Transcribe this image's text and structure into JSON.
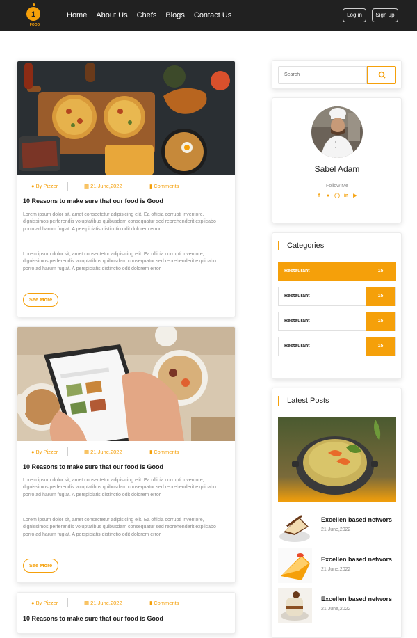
{
  "nav": {
    "links": [
      "Home",
      "About Us",
      "Chefs",
      "Blogs",
      "Contact Us"
    ],
    "login": "Log in",
    "signup": "Sign up",
    "logo_text": "FOOD"
  },
  "posts": [
    {
      "author": "By Pizzer",
      "date": "21 June,2022",
      "comments": "Comments",
      "title": "10 Reasons to make sure that our food is Good",
      "para1": "Lorem ipsum dolor sit, amet consectetur adipisicing elit. Ea officia corrupti inventore, dignissimos perferendis voluptatibus quibusdam consequatur sed reprehenderit explicabo porro ad harum fugiat. A perspiciatis distinctio odit dolorem error.",
      "para2": "Lorem ipsum dolor sit, amet consectetur adipisicing elit. Ea officia corrupti inventore, dignissimos perferendis voluptatibus quibusdam consequatur sed reprehenderit explicabo porro ad harum fugiat. A perspiciatis distinctio odit dolorem error.",
      "button": "See More",
      "image": "pizza-table"
    },
    {
      "author": "By Pizzer",
      "date": "21 June,2022",
      "comments": "Comments",
      "title": "10 Reasons to make sure that our food is Good",
      "para1": "Lorem ipsum dolor sit, amet consectetur adipisicing elit. Ea officia corrupti inventore, dignissimos perferendis voluptatibus quibusdam consequatur sed reprehenderit explicabo porro ad harum fugiat. A perspiciatis distinctio odit dolorem error.",
      "para2": "Lorem ipsum dolor sit, amet consectetur adipisicing elit. Ea officia corrupti inventore, dignissimos perferendis voluptatibus quibusdam consequatur sed reprehenderit explicabo porro ad harum fugiat. A perspiciatis distinctio odit dolorem error.",
      "button": "See More",
      "image": "tablet-breakfast"
    },
    {
      "author": "By Pizzer",
      "date": "21 June,2022",
      "comments": "Comments",
      "title": "10 Reasons to make sure that our food is Good"
    }
  ],
  "sidebar": {
    "search_placeholder": "Search",
    "profile": {
      "name": "Sabel Adam",
      "follow": "Follow Me",
      "socials": [
        "facebook-icon",
        "twitter-icon",
        "instagram-icon",
        "linkedin-icon",
        "youtube-icon"
      ]
    },
    "categories": {
      "heading": "Categories",
      "items": [
        {
          "label": "Restaurant",
          "count": "15"
        },
        {
          "label": "Restaurant",
          "count": "15"
        },
        {
          "label": "Restaurant",
          "count": "15"
        },
        {
          "label": "Restaurant",
          "count": "15"
        }
      ]
    },
    "latest": {
      "heading": "Latest Posts",
      "items": [
        {
          "title": "Excellen based networs",
          "date": "21 June,2022"
        },
        {
          "title": "Excellen based networs",
          "date": "21 June,2022"
        },
        {
          "title": "Excellen based networs",
          "date": "21 June,2022"
        }
      ]
    }
  },
  "colors": {
    "accent": "#f5a00a",
    "nav_bg": "#212121"
  }
}
